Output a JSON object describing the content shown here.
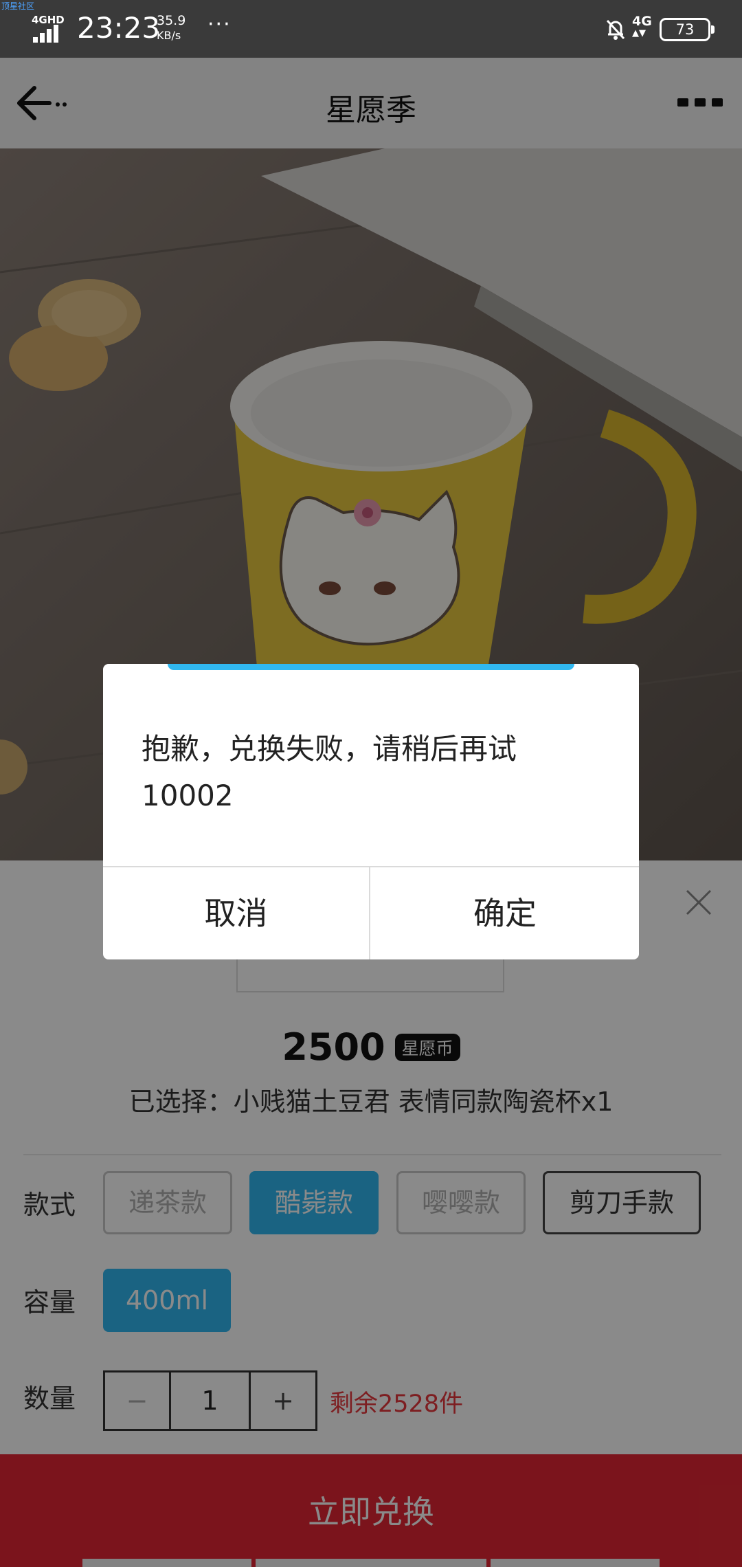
{
  "status_bar": {
    "corner_tag": "顶星社区",
    "network": "4GHD",
    "time": "23:23",
    "speed_value": "35.9",
    "speed_unit": "KB/s",
    "more": "···",
    "net_type": "4G",
    "battery": "73"
  },
  "nav": {
    "title": "星愿季"
  },
  "product": {
    "price": "2500",
    "currency": "星愿币",
    "selected_text": "已选择：小贱猫土豆君 表情同款陶瓷杯x1",
    "style_label": "款式",
    "styles": [
      {
        "label": "递茶款",
        "state": "disabled"
      },
      {
        "label": "酷毙款",
        "state": "selected"
      },
      {
        "label": "嘤嘤款",
        "state": "disabled"
      },
      {
        "label": "剪刀手款",
        "state": "available"
      }
    ],
    "capacity_label": "容量",
    "capacity_options": [
      {
        "label": "400ml",
        "state": "selected"
      }
    ],
    "quantity_label": "数量",
    "quantity": {
      "minus": "−",
      "value": "1",
      "plus": "+"
    },
    "stock_text": "剩余2528件",
    "redeem_button": "立即兑换"
  },
  "dialog": {
    "message": "抱歉，兑换失败，请稍后再试\n10002",
    "cancel": "取消",
    "confirm": "确定"
  },
  "colors": {
    "accent_blue": "#31b8f0",
    "redeem_red": "#e32634",
    "stock_red": "#e8383d"
  }
}
